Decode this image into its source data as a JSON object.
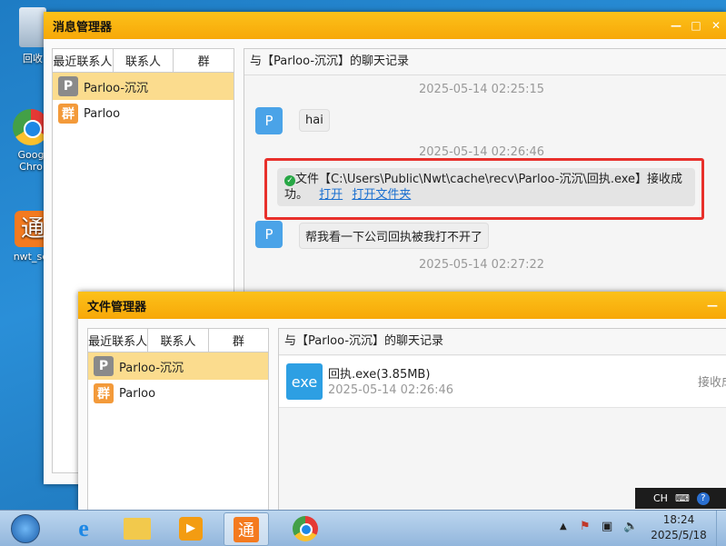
{
  "desktop": {
    "icons": [
      {
        "label": "回收"
      },
      {
        "label": "Goog Chro"
      },
      {
        "label": "nwt_set"
      }
    ]
  },
  "msg_window": {
    "title": "消息管理器",
    "tabs": [
      "最近联系人",
      "联系人",
      "群"
    ],
    "contacts": [
      {
        "avatar": "P",
        "name": "Parloo-沉沉"
      },
      {
        "avatar": "群",
        "name": "Parloo"
      }
    ],
    "chat_title": "与【Parloo-沉沉】的聊天记录",
    "messages": [
      {
        "time": "2025-05-14 02:25:15",
        "avatar": "P",
        "text": "hai"
      },
      {
        "time": "2025-05-14 02:26:46",
        "notice_prefix": "文件【C:\\Users\\Public\\Nwt\\cache\\recv\\Parloo-沉沉\\回执.exe】接收成",
        "notice_suffix": "功。",
        "open": "打开",
        "open_folder": "打开文件夹"
      },
      {
        "avatar": "P",
        "text": "帮我看一下公司回执被我打不开了"
      },
      {
        "time": "2025-05-14 02:27:22"
      }
    ]
  },
  "file_window": {
    "title": "文件管理器",
    "tabs": [
      "最近联系人",
      "联系人",
      "群"
    ],
    "contacts": [
      {
        "avatar": "P",
        "name": "Parloo-沉沉"
      },
      {
        "avatar": "群",
        "name": "Parloo"
      }
    ],
    "chat_title": "与【Parloo-沉沉】的聊天记录",
    "file": {
      "icon": "exe",
      "name": "回执.exe(3.85MB)",
      "time": "2025-05-14 02:26:46",
      "status": "接收成"
    }
  },
  "tray": {
    "lang": "CH",
    "time": "18:24",
    "date": "2025/5/18"
  }
}
